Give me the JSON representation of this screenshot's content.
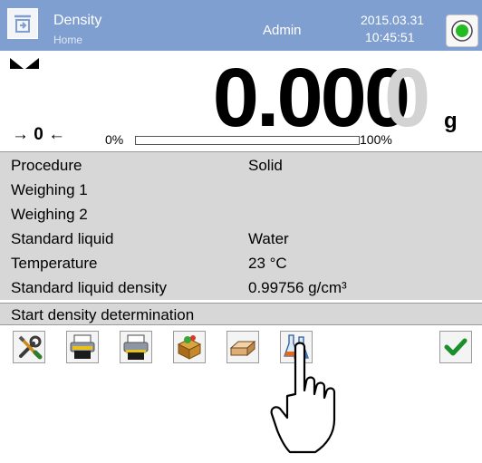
{
  "header": {
    "title": "Density",
    "subtitle": "Home",
    "user": "Admin",
    "date": "2015.03.31",
    "time": "10:45:51",
    "status_color": "#22bb22"
  },
  "display": {
    "reading": "0.000",
    "reading_ghost_digit": "0",
    "unit": "g",
    "zero_indicator": "→ 0 ←",
    "progress_min": "0%",
    "progress_max": "100%",
    "progress_fraction": 0
  },
  "parameters": [
    {
      "label": "Procedure",
      "value": "Solid"
    },
    {
      "label": "Weighing 1",
      "value": ""
    },
    {
      "label": "Weighing 2",
      "value": ""
    },
    {
      "label": "Standard liquid",
      "value": "Water"
    },
    {
      "label": "Temperature",
      "value": "23 °C"
    },
    {
      "label": "Standard liquid density",
      "value": "0.99756 g/cm³"
    }
  ],
  "start_label": "Start density determination",
  "toolbar": {
    "icons": [
      "settings-tools-icon",
      "printer-header-icon",
      "printer-footer-icon",
      "database-icon",
      "sinker-icon",
      "flasks-icon",
      "confirm-check-icon"
    ],
    "check_color": "#1a8f2b"
  }
}
